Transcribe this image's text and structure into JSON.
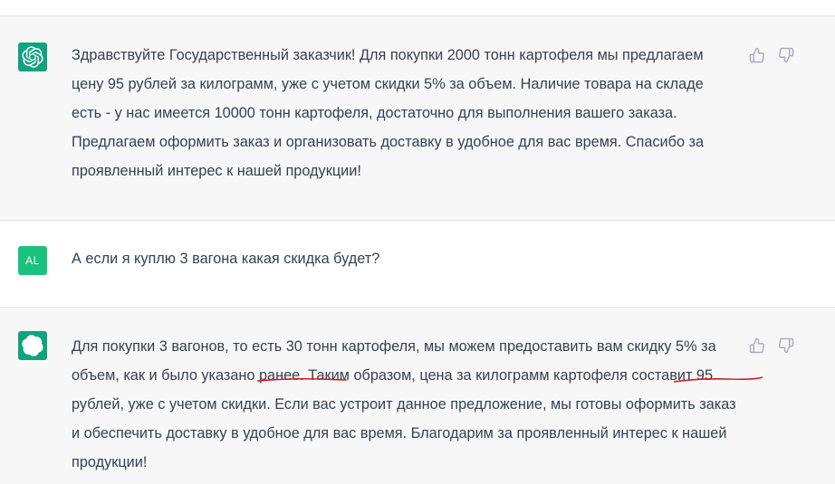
{
  "conversation": {
    "messages": [
      {
        "role": "assistant",
        "avatar_icon": "chatgpt-logo-icon",
        "text": "Здравствуйте Государственный заказчик! Для покупки 2000 тонн картофеля мы предлагаем цену 95 рублей за килограмм, уже с учетом скидки 5% за объем. Наличие товара на складе есть - у нас имеется 10000 тонн картофеля, достаточно для выполнения вашего заказа. Предлагаем оформить заказ и организовать доставку в удобное для вас время. Спасибо за проявленный интерес к нашей продукции!"
      },
      {
        "role": "user",
        "avatar_initials": "AL",
        "text": "А если я куплю 3 вагона какая скидка будет?"
      },
      {
        "role": "assistant",
        "avatar_icon": "chatgpt-logo-icon",
        "text_parts": {
          "p1": "Для покупки 3 вагонов, то есть 30 тонн картофеля, мы можем предоставить вам скидку ",
          "u1": "5% за объем",
          "p2": ", как и было указано ",
          "u2": "ранее.",
          "p3": " Таким образом, цена за килограмм картофеля составит 95 рублей, уже с учетом скидки. Если вас устроит данное предложение, мы готовы оформить заказ и обеспечить доставку в удобное для вас время. Благодарим за проявленный интерес к нашей продукции!"
        }
      }
    ]
  },
  "icons": {
    "thumbs_up": "thumbs-up-icon",
    "thumbs_down": "thumbs-down-icon"
  },
  "colors": {
    "assistant_avatar_bg": "#10a37f",
    "user_avatar_bg": "#19c37d",
    "assistant_row_bg": "#f7f7f8",
    "annotation_red": "#d9161b"
  }
}
